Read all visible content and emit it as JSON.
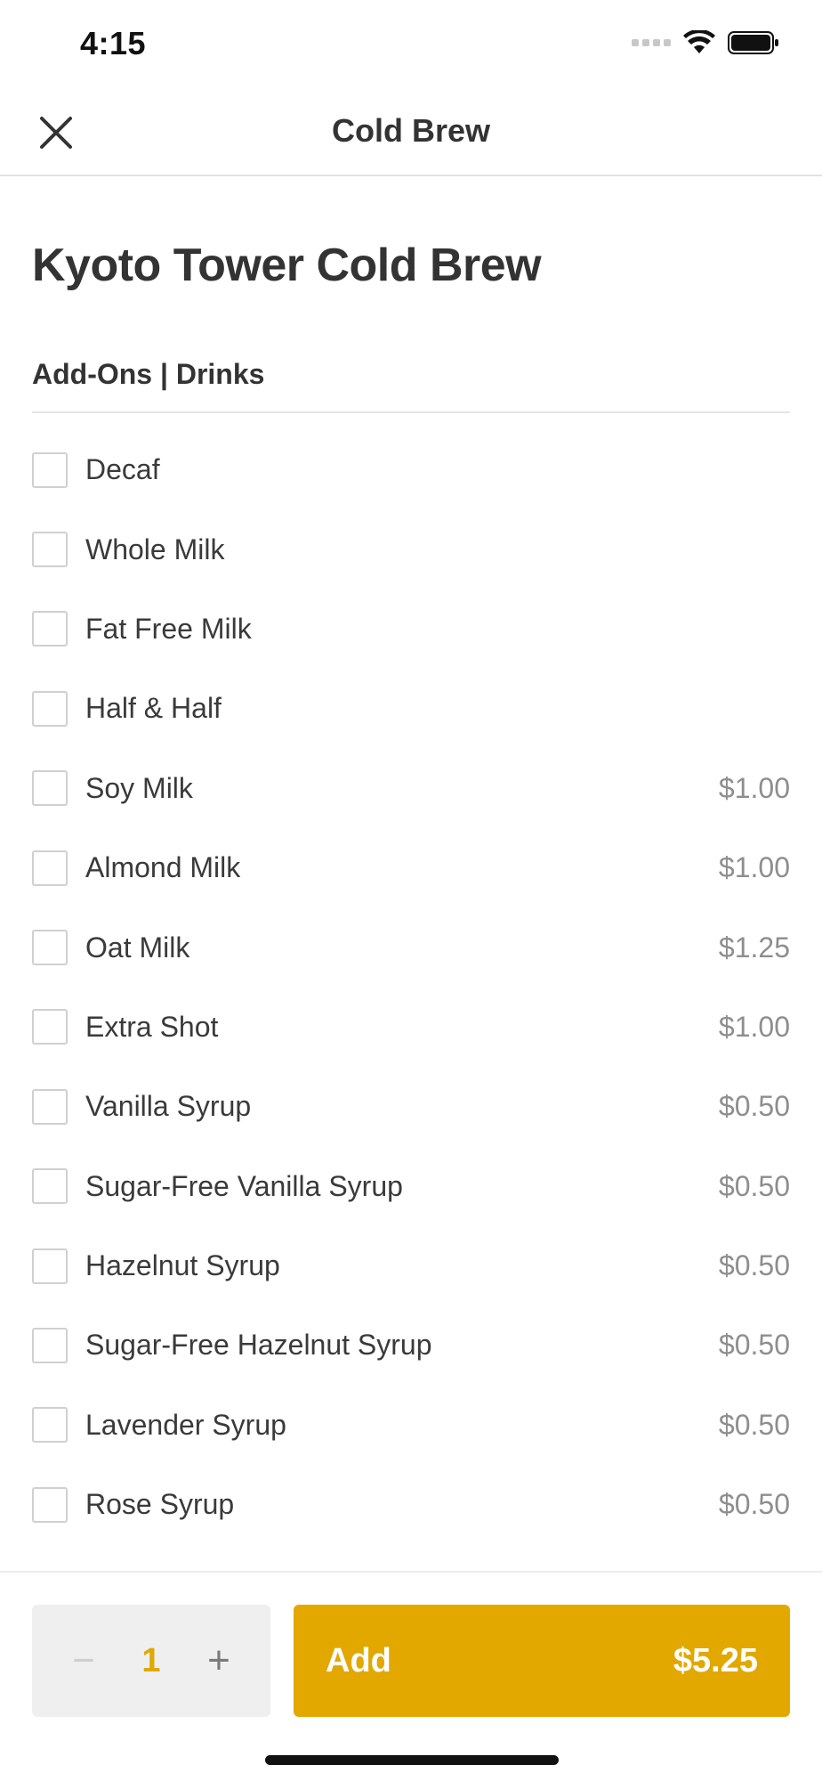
{
  "status_bar": {
    "time": "4:15"
  },
  "nav": {
    "title": "Cold Brew",
    "close_icon": "close-icon"
  },
  "product": {
    "title": "Kyoto Tower Cold Brew"
  },
  "section": {
    "title": "Add-Ons | Drinks"
  },
  "options": [
    {
      "label": "Decaf",
      "price": ""
    },
    {
      "label": "Whole Milk",
      "price": ""
    },
    {
      "label": "Fat Free Milk",
      "price": ""
    },
    {
      "label": "Half & Half",
      "price": ""
    },
    {
      "label": "Soy Milk",
      "price": "$1.00"
    },
    {
      "label": "Almond Milk",
      "price": "$1.00"
    },
    {
      "label": "Oat Milk",
      "price": "$1.25"
    },
    {
      "label": "Extra Shot",
      "price": "$1.00"
    },
    {
      "label": "Vanilla Syrup",
      "price": "$0.50"
    },
    {
      "label": "Sugar-Free Vanilla Syrup",
      "price": "$0.50"
    },
    {
      "label": "Hazelnut Syrup",
      "price": "$0.50"
    },
    {
      "label": "Sugar-Free Hazelnut Syrup",
      "price": "$0.50"
    },
    {
      "label": "Lavender Syrup",
      "price": "$0.50"
    },
    {
      "label": "Rose Syrup",
      "price": "$0.50"
    }
  ],
  "footer": {
    "quantity": "1",
    "minus_symbol": "−",
    "plus_symbol": "+",
    "add_label": "Add",
    "total_price": "$5.25"
  },
  "colors": {
    "accent": "#e2a800",
    "quantity_text": "#e0a800"
  }
}
